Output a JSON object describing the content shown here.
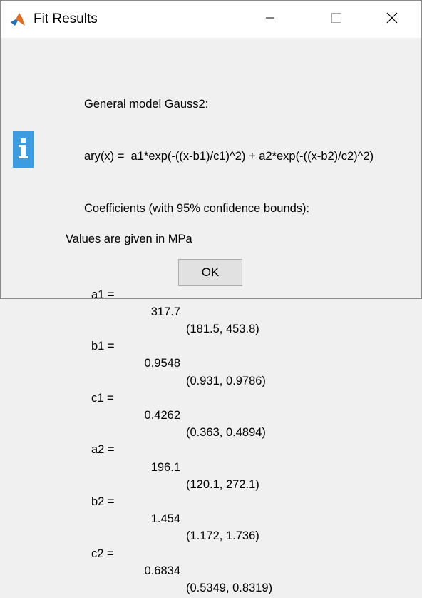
{
  "window": {
    "title": "Fit Results"
  },
  "message": {
    "model_line": "General model Gauss2:",
    "equation_line": "ary(x) =  a1*exp(-((x-b1)/c1)^2) + a2*exp(-((x-b2)/c2)^2)",
    "coefficients_header": "Coefficients (with 95% confidence bounds):",
    "coefficients": [
      {
        "name": "a1 =",
        "value": "317.7",
        "bounds": "(181.5, 453.8)"
      },
      {
        "name": "b1 =",
        "value": "0.9548",
        "bounds": "(0.931, 0.9786)"
      },
      {
        "name": "c1 =",
        "value": "0.4262",
        "bounds": "(0.363, 0.4894)"
      },
      {
        "name": "a2 =",
        "value": "196.1",
        "bounds": "(120.1, 272.1)"
      },
      {
        "name": "b2 =",
        "value": "1.454",
        "bounds": "(1.172, 1.736)"
      },
      {
        "name": "c2 =",
        "value": "0.6834",
        "bounds": "(0.5349, 0.8319)"
      }
    ],
    "note": "Values are given in MPa"
  },
  "buttons": {
    "ok_label": "OK"
  },
  "icons": {
    "app": "matlab-icon",
    "info": "info-icon",
    "minimize": "minimize-icon",
    "maximize": "maximize-icon",
    "close": "close-icon"
  },
  "colors": {
    "info_icon_bg": "#3d9be0",
    "titlebar_bg": "#ffffff",
    "body_bg": "#f0f0f0",
    "button_bg": "#e1e1e1"
  }
}
